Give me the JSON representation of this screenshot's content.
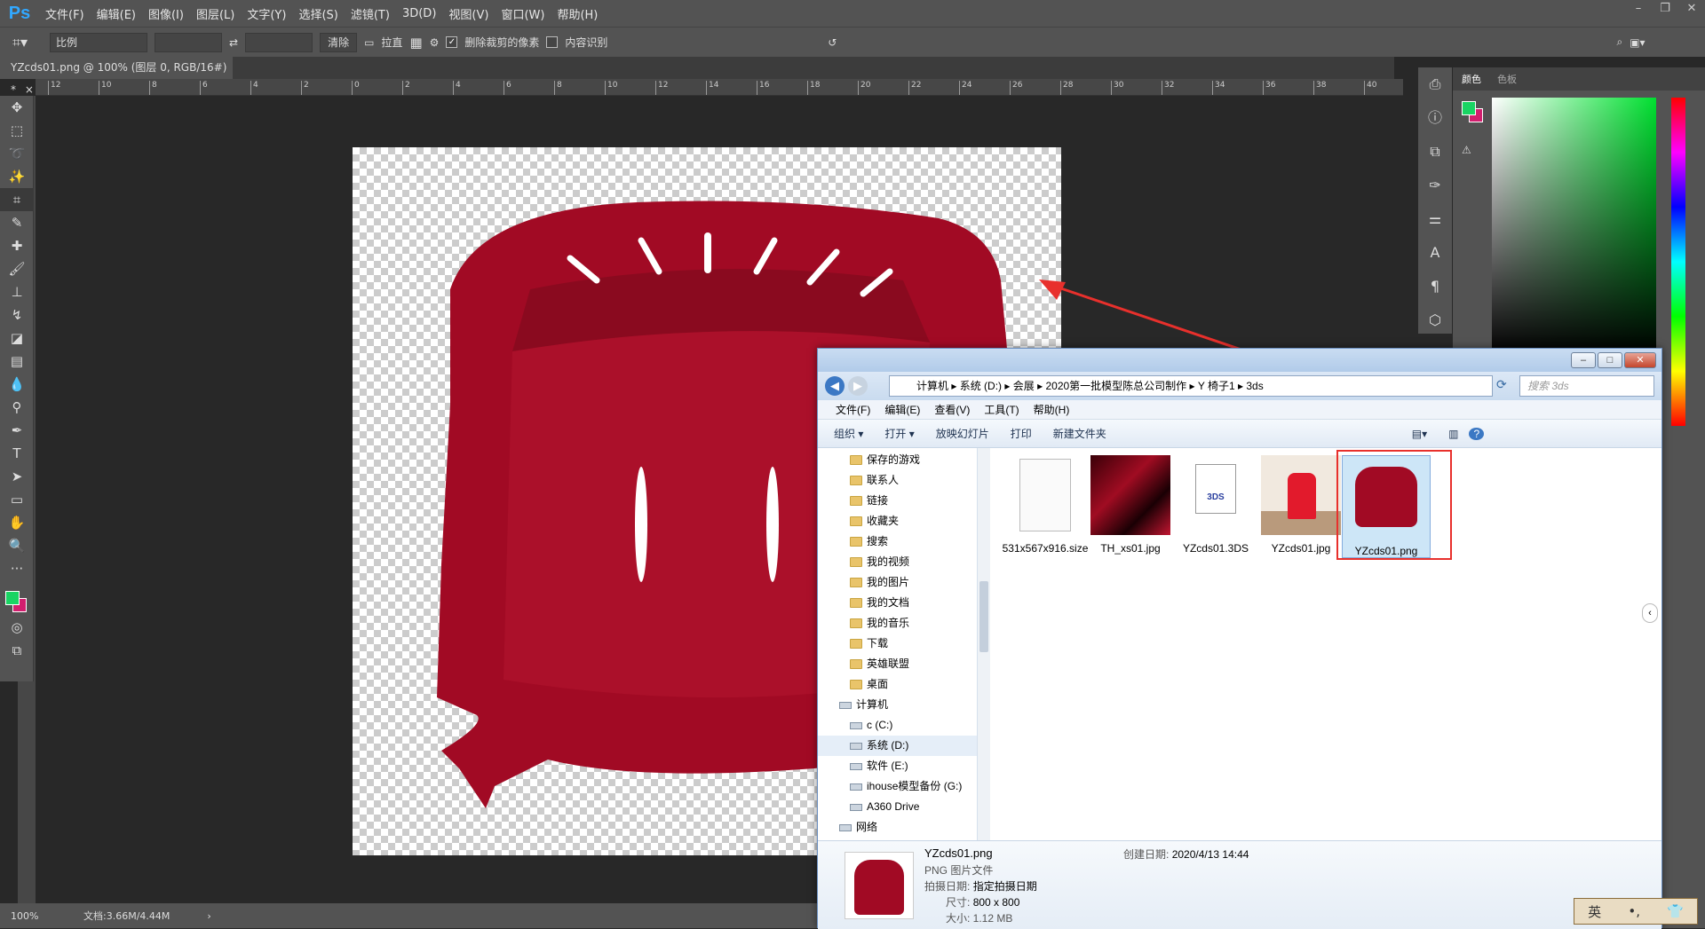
{
  "app": {
    "logo": "Ps",
    "menus": [
      "文件(F)",
      "编辑(E)",
      "图像(I)",
      "图层(L)",
      "文字(Y)",
      "选择(S)",
      "滤镜(T)",
      "3D(D)",
      "视图(V)",
      "窗口(W)",
      "帮助(H)"
    ]
  },
  "options": {
    "ratio_label": "比例",
    "clear_label": "清除",
    "straighten_label": "拉直",
    "delete_cropped_label": "删除裁剪的像素",
    "delete_cropped_checked": true,
    "content_aware_label": "内容识别",
    "content_aware_checked": false
  },
  "document": {
    "tab_title": "YZcds01.png @ 100% (图层 0, RGB/16#) *",
    "close_icon": "×"
  },
  "ruler": {
    "h_ticks": [
      "12",
      "10",
      "8",
      "6",
      "4",
      "2",
      "0",
      "2",
      "4",
      "6",
      "8",
      "10",
      "12",
      "14",
      "16",
      "18",
      "20",
      "22",
      "24",
      "26",
      "28",
      "30",
      "32",
      "34",
      "36",
      "38",
      "40"
    ]
  },
  "status": {
    "zoom": "100%",
    "doc_size": "文档:3.66M/4.44M"
  },
  "panels": {
    "tabs": [
      "颜色",
      "色板"
    ],
    "fg_color": "#19d463",
    "bg_color": "#d21e6e"
  },
  "explorer": {
    "breadcrumb": [
      "计算机",
      "系统 (D:)",
      "会展",
      "2020第一批模型陈总公司制作",
      "Y 椅子1",
      "3ds"
    ],
    "search_placeholder": "搜索 3ds",
    "menu": [
      "文件(F)",
      "编辑(E)",
      "查看(V)",
      "工具(T)",
      "帮助(H)"
    ],
    "commands": [
      "组织 ▾",
      "打开 ▾",
      "放映幻灯片",
      "打印",
      "新建文件夹"
    ],
    "nav": [
      {
        "label": "保存的游戏",
        "kind": "folder"
      },
      {
        "label": "联系人",
        "kind": "folder"
      },
      {
        "label": "链接",
        "kind": "folder"
      },
      {
        "label": "收藏夹",
        "kind": "folder"
      },
      {
        "label": "搜索",
        "kind": "folder"
      },
      {
        "label": "我的视频",
        "kind": "folder"
      },
      {
        "label": "我的图片",
        "kind": "folder"
      },
      {
        "label": "我的文档",
        "kind": "folder"
      },
      {
        "label": "我的音乐",
        "kind": "folder"
      },
      {
        "label": "下载",
        "kind": "folder"
      },
      {
        "label": "英雄联盟",
        "kind": "folder"
      },
      {
        "label": "桌面",
        "kind": "folder"
      },
      {
        "label": "计算机",
        "kind": "computer"
      },
      {
        "label": "c (C:)",
        "kind": "drive"
      },
      {
        "label": "系统 (D:)",
        "kind": "drive"
      },
      {
        "label": "软件 (E:)",
        "kind": "drive"
      },
      {
        "label": "ihouse模型备份 (G:)",
        "kind": "drive"
      },
      {
        "label": "A360 Drive",
        "kind": "drive"
      },
      {
        "label": "网络",
        "kind": "network"
      }
    ],
    "files": [
      {
        "name": "531x567x916.size",
        "type": "blank"
      },
      {
        "name": "TH_xs01.jpg",
        "type": "texture"
      },
      {
        "name": "YZcds01.3DS",
        "type": "3ds",
        "badge": "3DS"
      },
      {
        "name": "YZcds01.jpg",
        "type": "photo"
      },
      {
        "name": "YZcds01.png",
        "type": "png",
        "selected": true
      }
    ],
    "details": {
      "name": "YZcds01.png",
      "type": "PNG 图片文件",
      "shot_label": "拍摄日期:",
      "shot_value": "指定拍摄日期",
      "size_label": "尺寸:",
      "size_value": "800 x 800",
      "filesize": "大小: 1.12 MB",
      "created_label": "创建日期:",
      "created_value": "2020/4/13 14:44"
    }
  },
  "ime": {
    "label": "英"
  }
}
